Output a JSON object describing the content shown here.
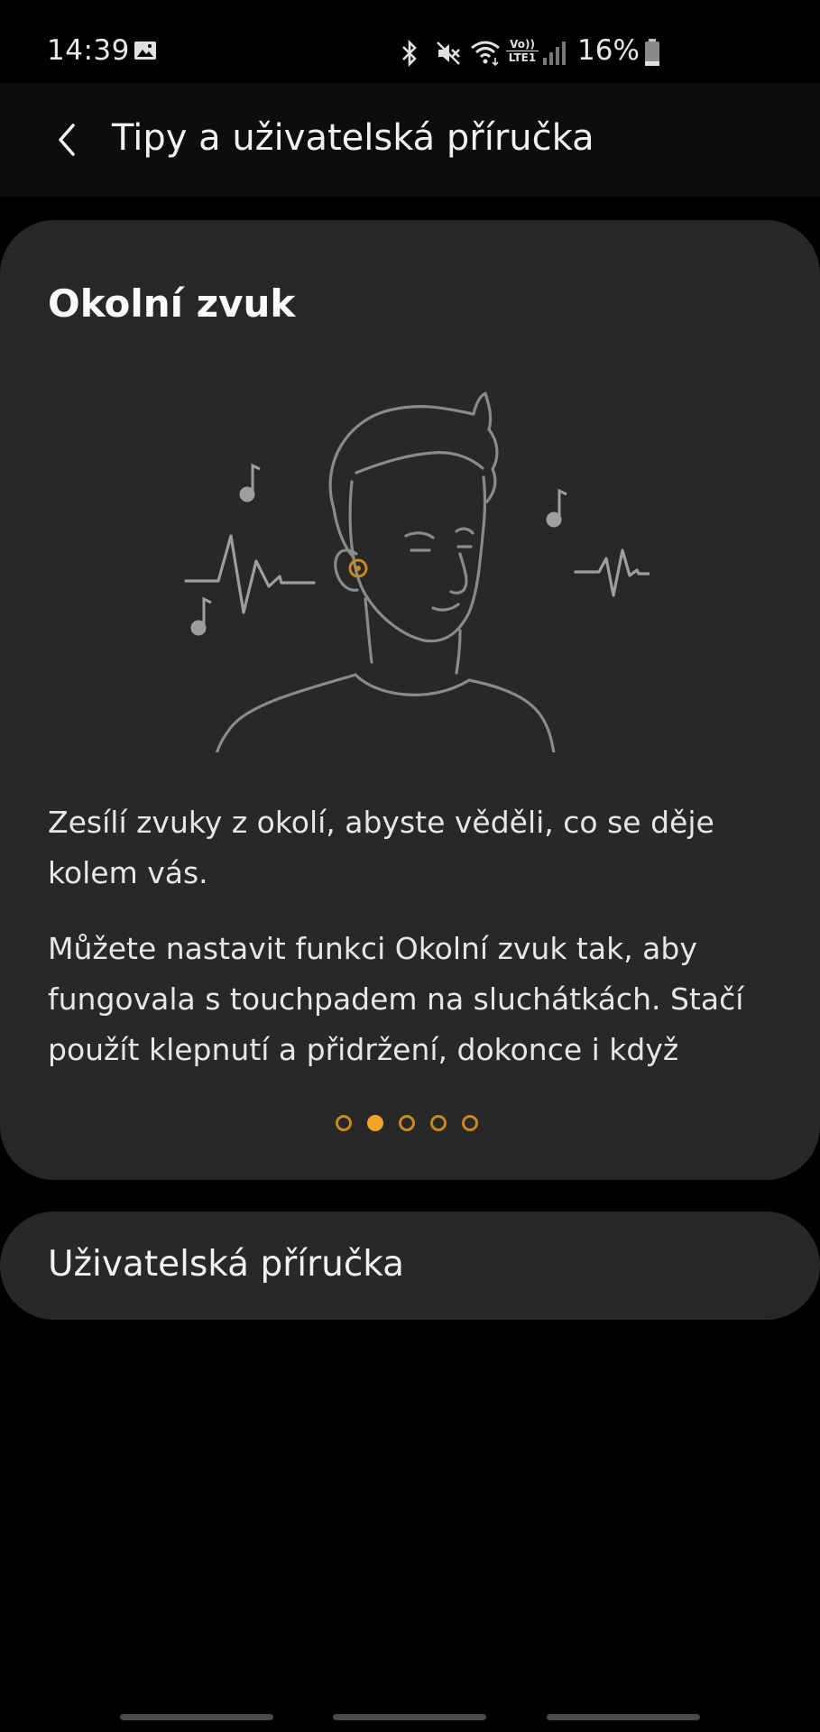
{
  "status_bar": {
    "time": "14:39",
    "battery_percent": "16%",
    "network_label_top": "Vo))",
    "network_label_bottom": "LTE1",
    "icons": [
      "gallery-icon",
      "bluetooth-icon",
      "mute-icon",
      "wifi-icon",
      "volte-icon",
      "signal-icon",
      "battery-icon"
    ]
  },
  "app_bar": {
    "title": "Tipy a uživatelská příručka",
    "back_icon": "chevron-left-icon"
  },
  "tip": {
    "title": "Okolní zvuk",
    "paragraph_1": "Zesílí zvuky z okolí, abyste věděli, co se děje kolem vás.",
    "paragraph_2": "Můžete nastavit funkci Okolní zvuk tak, aby fungovala s touchpadem na sluchátkách. Stačí použít klepnutí a přidržení, dokonce i když",
    "page_count": 5,
    "current_page": 2,
    "accent_color": "#f2a42a"
  },
  "manual": {
    "label": "Uživatelská příručka"
  }
}
